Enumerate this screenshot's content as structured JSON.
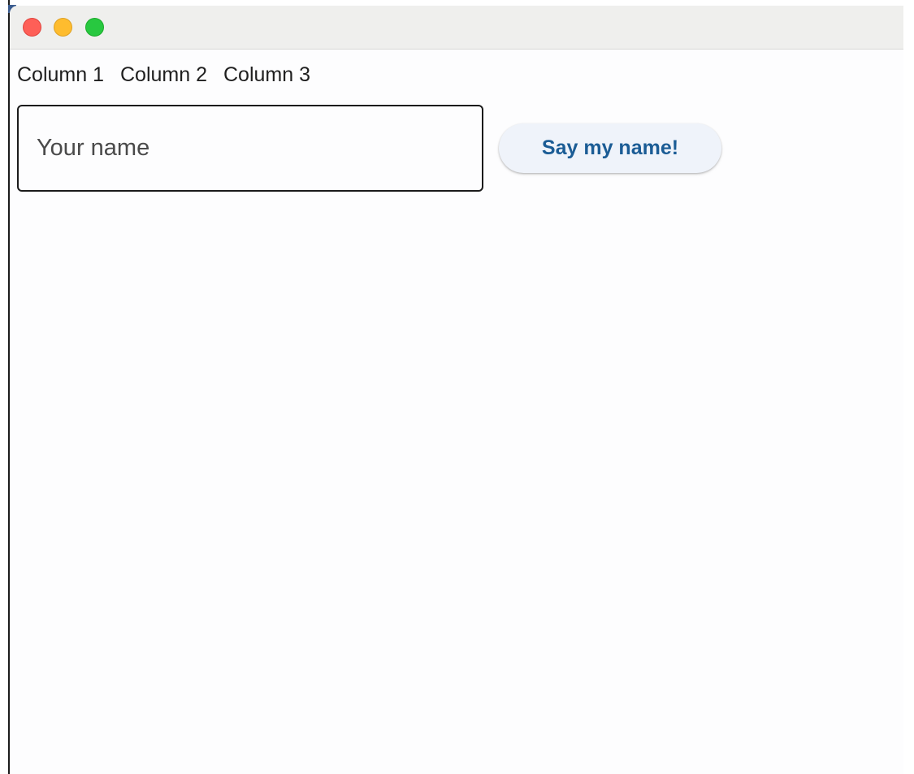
{
  "columns": [
    "Column 1",
    "Column 2",
    "Column 3"
  ],
  "name_input": {
    "placeholder": "Your name",
    "value": ""
  },
  "say_button": {
    "label": "Say my name!"
  },
  "colors": {
    "accent_text": "#1b5c95",
    "button_background": "#eff3fa",
    "titlebar_background": "#efefed",
    "close": "#fe5f57",
    "minimize": "#febc2e",
    "zoom": "#28c840"
  }
}
